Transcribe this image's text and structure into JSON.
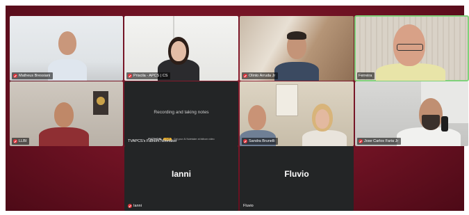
{
  "participants": [
    {
      "name": "Matheus Bressiani",
      "muted": true
    },
    {
      "name": "Priscila - APCS | CS",
      "muted": true
    },
    {
      "name": "Olinto Arruda Jr",
      "muted": true
    },
    {
      "name": "Ferreira",
      "muted": false,
      "active_speaker": true
    },
    {
      "name": "LLBI",
      "muted": true
    },
    {
      "name": "TVAPCS's Fathom Notetaker",
      "muted": false
    },
    {
      "name": "Sandra Brunelli",
      "muted": true
    },
    {
      "name": "Jose Carlos Faria Jr",
      "muted": true
    },
    {
      "name": "Ianni",
      "muted": true
    },
    {
      "name": "Fluvio",
      "muted": false
    }
  ],
  "notetaker": {
    "status": "Recording and taking notes",
    "brand": "FATHOM",
    "badge": "LIVE",
    "footer": "Get your AI Notetaker at fathom.video"
  },
  "placeholders": {
    "ianni": "Ianni",
    "fluvio": "Fluvio"
  },
  "colors": {
    "background": "#6e1223",
    "active_border": "#7fd17a",
    "muted_icon": "#e0343b",
    "empty_tile": "#232526"
  }
}
